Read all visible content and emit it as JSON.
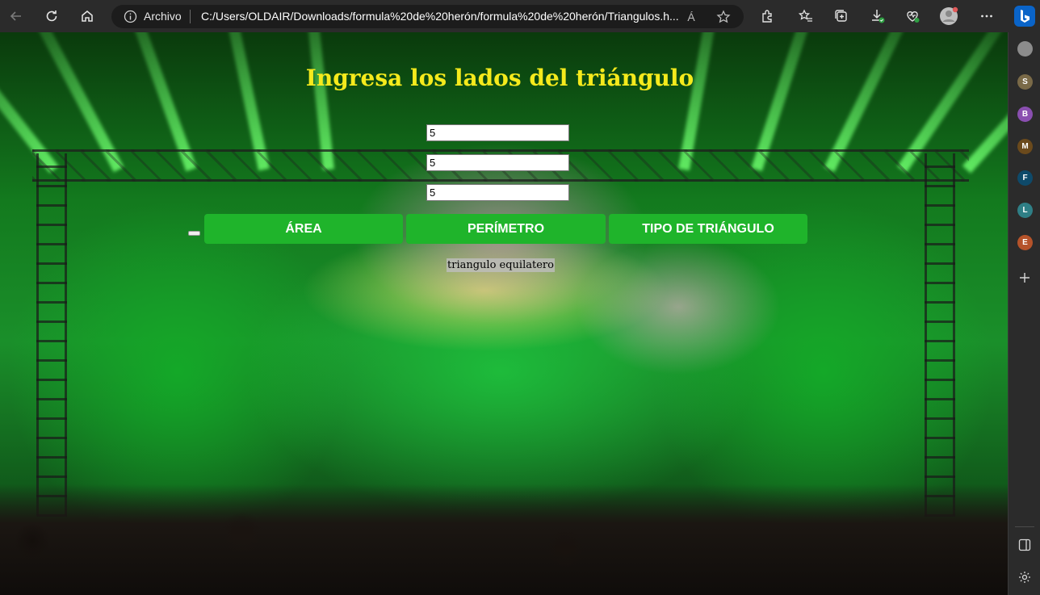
{
  "browser": {
    "address_prefix": "Archivo",
    "url": "C:/Users/OLDAIR/Downloads/formula%20de%20herón/formula%20de%20herón/Triangulos.h...",
    "read_aloud_icon": "Á",
    "profile_avatars": [
      {
        "letter": "S",
        "color": "#7a6a48"
      },
      {
        "letter": "B",
        "color": "#8a4fb0"
      },
      {
        "letter": "M",
        "color": "#6b4a1c"
      },
      {
        "letter": "F",
        "color": "#0e4a6a"
      },
      {
        "letter": "L",
        "color": "#2f7f86"
      },
      {
        "letter": "E",
        "color": "#b5532a"
      }
    ]
  },
  "page": {
    "title": "Ingresa los lados del triángulo",
    "inputs": [
      {
        "value": "5"
      },
      {
        "value": "5"
      },
      {
        "value": "5"
      }
    ],
    "buttons": {
      "area": "ÁREA",
      "perimetro": "PERÍMETRO",
      "tipo": "TIPO DE TRIÁNGULO"
    },
    "result": "triangulo equilatero"
  },
  "colors": {
    "title": "#f5ea1c",
    "button_bg": "#1fb42b",
    "button_text": "#ffffff"
  }
}
